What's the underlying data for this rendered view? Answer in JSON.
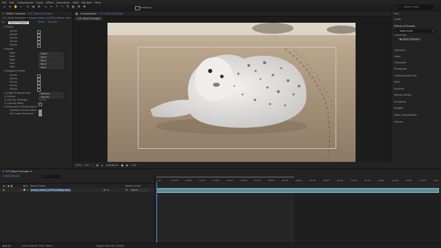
{
  "menu": [
    "File",
    "Edit",
    "Composition",
    "Layer",
    "Effect",
    "Animation",
    "View",
    "Window",
    "Help"
  ],
  "toolbar": {
    "snapping": "Snapping",
    "search_placeholder": "Search Help"
  },
  "effect_controls": {
    "tab": "Effect Controls",
    "layer_title": "TUT_Mask Prompter",
    "breadcrumb": "TUT_Mask Prompter • pexels_video_(1)(IPP)(1080p).mp4",
    "effect_name": "Mask Prompter",
    "reset": "Reset",
    "register": "Register",
    "points_header": "Points",
    "active_rows": [
      "Active",
      "Active",
      "Active",
      "Active",
      "Active"
    ],
    "boxes_header": "Boxes",
    "path_rows": [
      {
        "label": "Path",
        "value": "Mask 1"
      },
      {
        "label": "Path",
        "value": "None"
      },
      {
        "label": "Path",
        "value": "None"
      },
      {
        "label": "Path",
        "value": "None"
      },
      {
        "label": "Path",
        "value": "None"
      }
    ],
    "negative_header": "Negative Points",
    "neg_rows": [
      "Active",
      "Active",
      "Active",
      "Active",
      "Active"
    ],
    "edge_label": "Edge Enhancement",
    "edge_value": "Medium",
    "output_label": "Output",
    "output_value": "Overlay",
    "overlay_strength_label": "Overlay Strength",
    "overlay_strength_value": "70.0%",
    "overlay_mask_label": "Overlay Mask",
    "advanced_header": "Advanced & Performance",
    "hw_accel_label": "Hardware Acceleration",
    "lower_precision_label": "Use Lower Precision"
  },
  "composition": {
    "tab": "Composition",
    "comp_name": "TUT_Mask Prompter",
    "sub_tab": "TUT_Mask Prompter",
    "footer": [
      "(74%)",
      "Full",
      "0;00;00;02",
      "+0.0"
    ]
  },
  "right_panel": {
    "items_top": [
      "Info",
      "Audio"
    ],
    "effects_header": "Effects & Presets",
    "search_value": "mask prom",
    "tree_folder": "Aescripts",
    "tree_item": "Mask Prompter",
    "items_bottom": [
      "Libraries",
      "Align",
      "Character",
      "Paragraph",
      "Content-Aware Fill",
      "Paint",
      "Brushes",
      "Motion Sketch",
      "Smoother",
      "Wiggler",
      "Mask Interpolation",
      "Tracker"
    ]
  },
  "timeline": {
    "tab": "TUT_Mask Prompter",
    "timecode": "0;00;00;02",
    "col_source": "Source Name",
    "col_parent": "Parent & Link",
    "layer_num": "1",
    "layer_name": "pexels_video_(1)(IPP)(1080p).mp4",
    "parent_value": "None",
    "ruler": [
      "00f",
      "00:15f",
      "01:00f",
      "01:15f",
      "02:00f",
      "02:15f",
      "03:00f",
      "03:15f",
      "04:00f",
      "04:15f",
      "05:00f",
      "05:15f",
      "06:00f",
      "06:15f",
      "07:00f",
      "07:15f",
      "08:00f",
      "08:15f",
      "09:00f",
      "09:15f",
      "10:00"
    ]
  },
  "status": {
    "render_time": "Frame Render Time:  Mdms",
    "toggle": "Toggle Switches / Modes"
  }
}
